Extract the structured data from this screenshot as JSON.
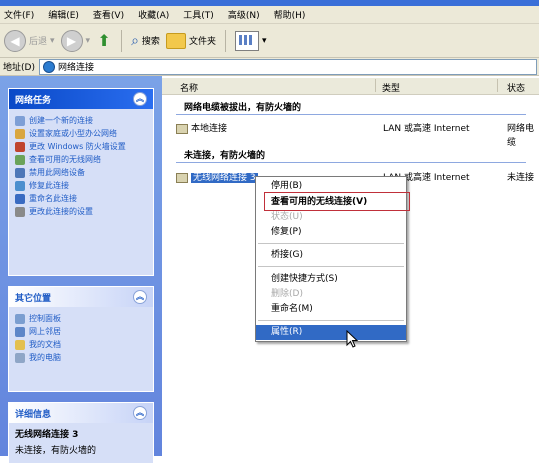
{
  "menu": [
    "文件(F)",
    "编辑(E)",
    "查看(V)",
    "收藏(A)",
    "工具(T)",
    "高级(N)",
    "帮助(H)"
  ],
  "toolbar": {
    "back_label": "后退",
    "search_label": "搜索",
    "folders_label": "文件夹"
  },
  "address": {
    "label": "地址(D)",
    "value": "网络连接"
  },
  "tasks_panel": {
    "title": "网络任务",
    "items": [
      "创建一个新的连接",
      "设置家庭或小型办公网络",
      "更改 Windows 防火墙设置",
      "查看可用的无线网络",
      "禁用此网络设备",
      "修复此连接",
      "重命名此连接",
      "更改此连接的设置"
    ]
  },
  "other_panel": {
    "title": "其它位置",
    "items": [
      "控制面板",
      "网上邻居",
      "我的文档",
      "我的电脑"
    ]
  },
  "details_panel": {
    "title": "详细信息",
    "name": "无线网络连接 3",
    "status": "未连接，有防火墙的"
  },
  "columns": {
    "name": "名称",
    "type": "类型",
    "status": "状态"
  },
  "groups": [
    {
      "title": "网络电缆被拔出，有防火墙的",
      "row": {
        "name": "本地连接",
        "type": "LAN 或高速 Internet",
        "status": "网络电缆"
      }
    },
    {
      "title": "未连接，有防火墙的",
      "row": {
        "name": "无线网络连接 3",
        "type": "LAN 或高速 Internet",
        "status": "未连接"
      }
    }
  ],
  "context_menu": {
    "items": [
      {
        "label": "停用(B)",
        "state": "normal"
      },
      {
        "label": "查看可用的无线连接(V)",
        "state": "bold"
      },
      {
        "label": "状态(U)",
        "state": "disabled"
      },
      {
        "label": "修复(P)",
        "state": "normal"
      },
      {
        "label": "桥接(G)",
        "state": "normal"
      },
      {
        "label": "创建快捷方式(S)",
        "state": "normal"
      },
      {
        "label": "删除(D)",
        "state": "disabled"
      },
      {
        "label": "重命名(M)",
        "state": "normal"
      },
      {
        "label": "属性(R)",
        "state": "highlighted"
      }
    ]
  },
  "colors": {
    "selection": "#316ac5",
    "annotation_box": "#c0303a",
    "task_link": "#215dc6"
  }
}
